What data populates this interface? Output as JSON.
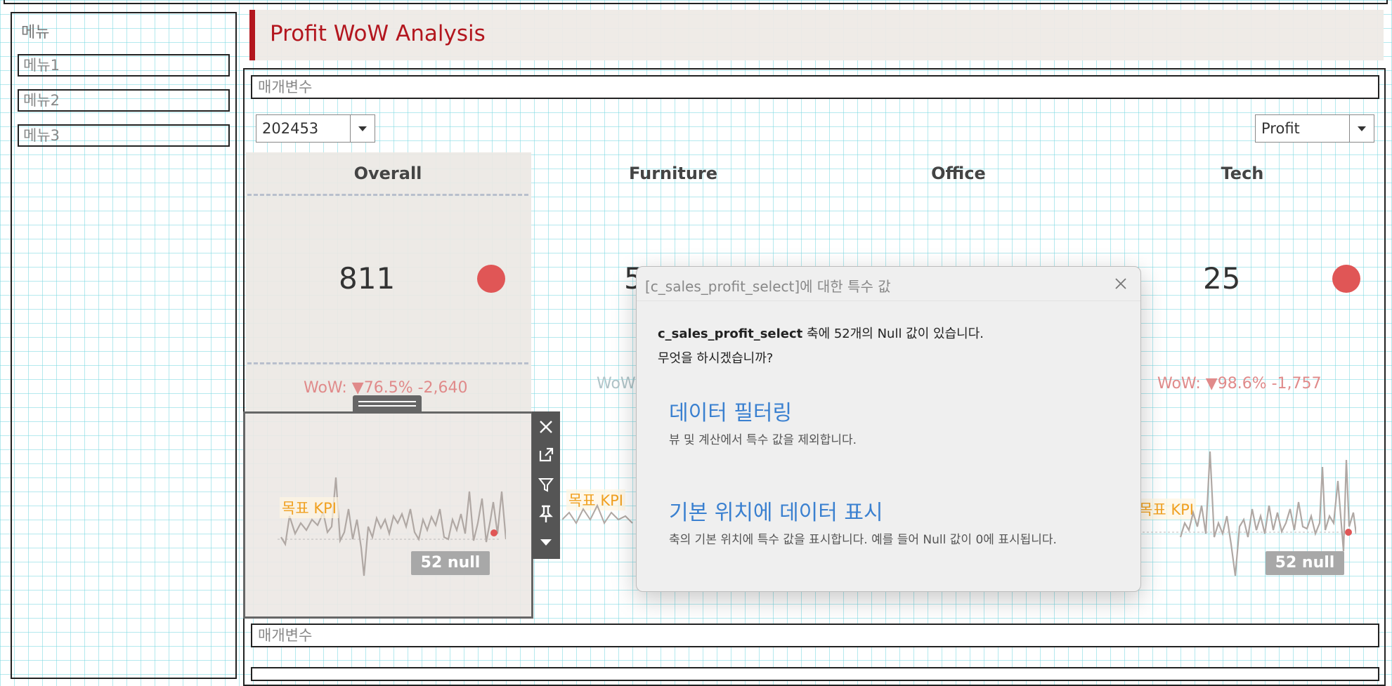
{
  "sidebar": {
    "title": "메뉴",
    "items": [
      {
        "label": "메뉴1"
      },
      {
        "label": "메뉴2"
      },
      {
        "label": "메뉴3"
      }
    ]
  },
  "header": {
    "title": "Profit WoW Analysis",
    "accent_color": "#b3161e"
  },
  "params": {
    "top_label": "매개변수",
    "bottom_label": "매개변수"
  },
  "filters": {
    "week": "202453",
    "measure": "Profit"
  },
  "categories": [
    {
      "title": "Overall",
      "kpi": "811",
      "wow": "WoW: ▼76.5% -2,640",
      "target_label": "목표 KPI",
      "null_label": "52 null"
    },
    {
      "title": "Furniture",
      "kpi": "5",
      "wow": "WoW",
      "target_label": "목표 KPI"
    },
    {
      "title": "Office"
    },
    {
      "title": "Tech",
      "kpi": "25",
      "wow": "WoW: ▼98.6% -1,757",
      "target_label": "목표 KPI",
      "null_label": "52 null"
    }
  ],
  "status_colors": {
    "down": "#e05656"
  },
  "toolbar_icons": [
    "close-icon",
    "open-icon",
    "filter-icon",
    "pin-icon",
    "more-icon"
  ],
  "dialog": {
    "title": "[c_sales_profit_select]에 대한 특수 값",
    "message_field": "c_sales_profit_select",
    "message_rest": " 축에 52개의 Null 값이 있습니다.",
    "question": "무엇을 하시겠습니까?",
    "option1": {
      "title": "데이터 필터링",
      "desc": "뷰 및 계산에서 특수 값을 제외합니다."
    },
    "option2": {
      "title": "기본 위치에 데이터 표시",
      "desc": "축의 기본 위치에 특수 값을 표시합니다. 예를 들어 Null 값이 0에 표시됩니다."
    }
  }
}
